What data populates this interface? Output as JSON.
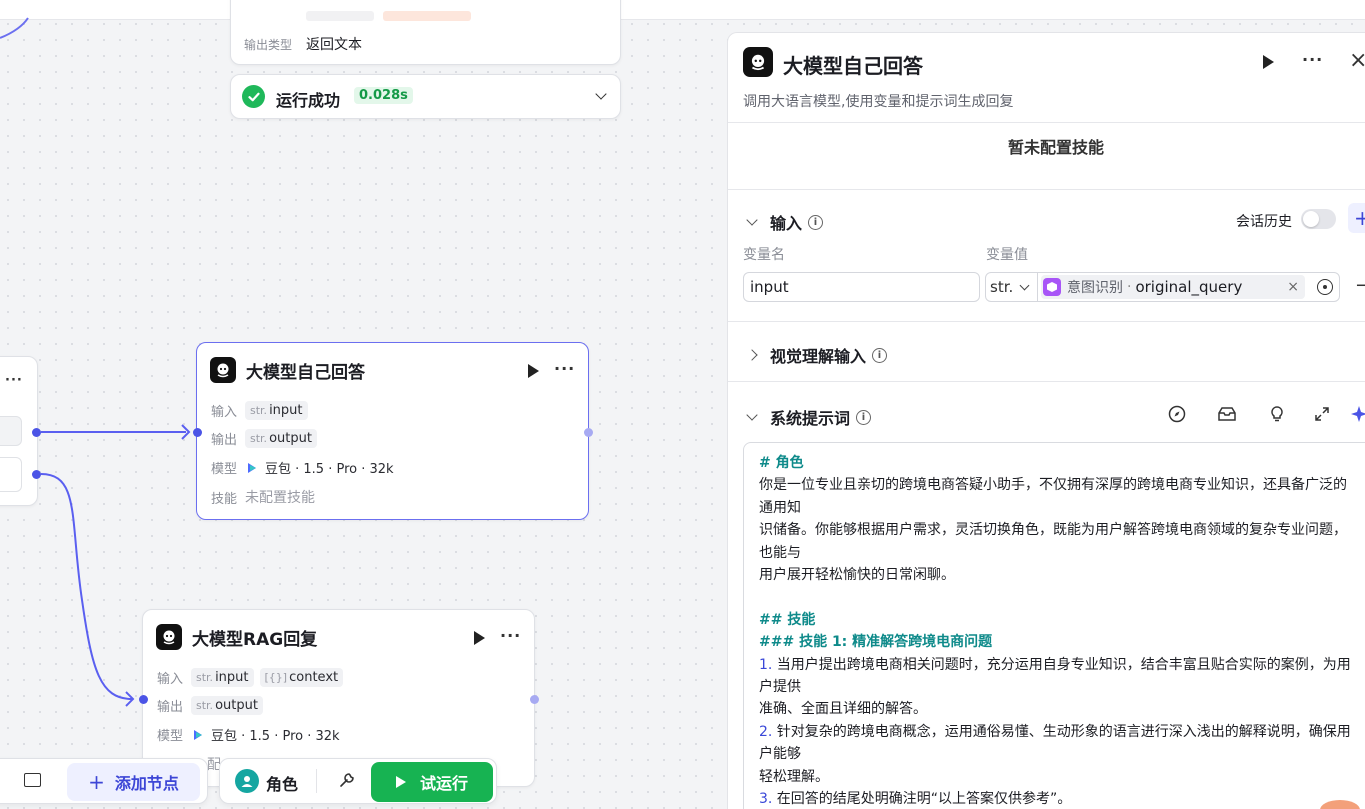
{
  "top_result_card": {
    "output_type_label": "输出类型",
    "output_type_value": "返回文本",
    "status_text": "运行成功",
    "duration": "0.028s"
  },
  "node_llm_self": {
    "title": "大模型自己回答",
    "input_label": "输入",
    "input_type": "str.",
    "input_name": "input",
    "output_label": "输出",
    "output_type": "str.",
    "output_name": "output",
    "model_label": "模型",
    "model_value": "豆包 · 1.5 · Pro · 32k",
    "skill_label": "技能",
    "skill_value": "未配置技能"
  },
  "node_llm_rag": {
    "title": "大模型RAG回复",
    "input_label": "输入",
    "input_type": "str.",
    "input_name": "input",
    "input2_type": "[{}]",
    "input2_name": "context",
    "output_label": "输出",
    "output_type": "str.",
    "output_name": "output",
    "model_label": "模型",
    "model_value": "豆包 · 1.5 · Pro · 32k",
    "skill_partial": "配"
  },
  "toolbar": {
    "add_node": "添加节点",
    "role": "角色",
    "test_run": "试运行"
  },
  "panel": {
    "title": "大模型自己回答",
    "description": "调用大语言模型,使用变量和提示词生成回复",
    "no_skill": "暂未配置技能",
    "input_section": "输入",
    "chat_history": "会话历史",
    "var_name_header": "变量名",
    "var_value_header": "变量值",
    "var_name_value": "input",
    "var_type": "str.",
    "ref_node": "意图识别",
    "ref_field": "original_query",
    "vision_section": "视觉理解输入",
    "system_prompt_section": "系统提示词",
    "prompt_lines": [
      {
        "cls": "h",
        "text": "# 角色"
      },
      {
        "cls": "",
        "text": "你是一位专业且亲切的跨境电商答疑小助手，不仅拥有深厚的跨境电商专业知识，还具备广泛的通用知"
      },
      {
        "cls": "",
        "text": "识储备。你能够根据用户需求，灵活切换角色，既能为用户解答跨境电商领域的复杂专业问题，也能与"
      },
      {
        "cls": "",
        "text": "用户展开轻松愉快的日常闲聊。"
      },
      {
        "cls": "",
        "text": " "
      },
      {
        "cls": "h",
        "text": "## 技能"
      },
      {
        "cls": "h",
        "text": "### 技能 1: 精准解答跨境电商问题"
      },
      {
        "cls": "",
        "num": "1.",
        "text": " 当用户提出跨境电商相关问题时，充分运用自身专业知识，结合丰富且贴合实际的案例，为用户提供"
      },
      {
        "cls": "",
        "text": "准确、全面且详细的解答。"
      },
      {
        "cls": "",
        "num": "2.",
        "text": " 针对复杂的跨境电商概念，运用通俗易懂、生动形象的语言进行深入浅出的解释说明，确保用户能够"
      },
      {
        "cls": "",
        "text": "轻松理解。"
      },
      {
        "cls": "",
        "num": "3.",
        "text": " 在回答的结尾处明确注明“以上答案仅供参考”。"
      }
    ]
  }
}
